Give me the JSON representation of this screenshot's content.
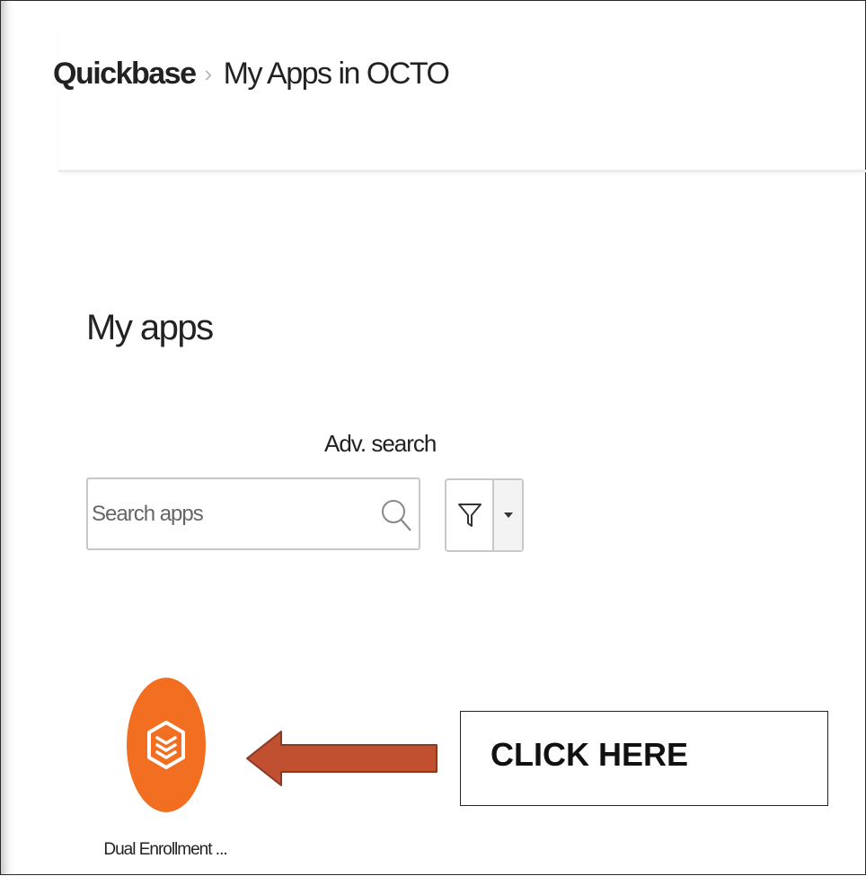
{
  "breadcrumb": {
    "root": "Quickbase",
    "separator": "›",
    "current": "My Apps in OCTO"
  },
  "page": {
    "title": "My apps"
  },
  "search": {
    "adv_label": "Adv. search",
    "placeholder": "Search apps",
    "value": ""
  },
  "filter": {
    "icon": "filter-icon",
    "dropdown_icon": "caret-down-icon"
  },
  "apps": [
    {
      "name": "Dual Enrollment ...",
      "icon": "app-cube-icon",
      "color": "#f26f21"
    }
  ],
  "annotation": {
    "callout": "CLICK HERE",
    "arrow_color": "#c0502f"
  }
}
